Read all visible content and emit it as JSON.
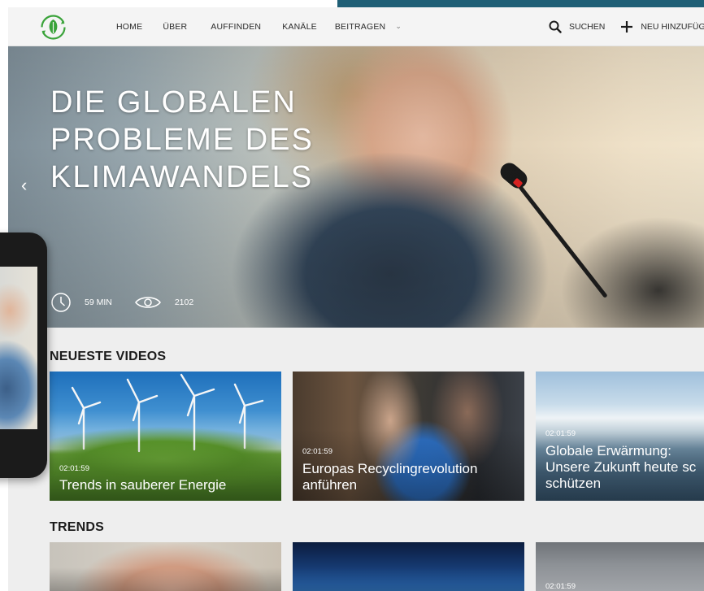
{
  "nav": {
    "items": [
      {
        "label": "HOME"
      },
      {
        "label": "ÜBER"
      },
      {
        "label": "AUFFINDEN"
      },
      {
        "label": "KANÄLE"
      },
      {
        "label": "BEITRAGEN"
      }
    ],
    "search_label": "SUCHEN",
    "add_label": "NEU HINZUFÜGEN"
  },
  "hero": {
    "title": "DIE GLOBALEN PROBLEME DES KLIMAWANDELS",
    "duration": "59 MIN",
    "views": "2102"
  },
  "sections": [
    {
      "title": "NEUESTE VIDEOS",
      "cards": [
        {
          "duration": "02:01:59",
          "title_lines": [
            "Trends in sauberer Energie"
          ]
        },
        {
          "duration": "02:01:59",
          "title_lines": [
            "Europas Recyclingrevolution",
            "anführen"
          ]
        },
        {
          "duration": "02:01:59",
          "title_lines": [
            "Globale Erwärmung:",
            "Unsere Zukunft heute sc",
            "schützen"
          ]
        }
      ]
    },
    {
      "title": "TRENDS",
      "cards": [
        {
          "duration": ""
        },
        {
          "duration": ""
        },
        {
          "duration": "02:01:59"
        }
      ]
    }
  ],
  "icons": {
    "logo": "recycle-leaf-logo-icon",
    "search": "search-icon",
    "add": "plus-icon",
    "prev": "chevron-left-icon",
    "clock": "clock-icon",
    "views": "eye-icon"
  },
  "colors": {
    "accent_strip": "#1f5f76",
    "logo_green": "#3aa33a",
    "page_bg": "#eeeeee"
  }
}
